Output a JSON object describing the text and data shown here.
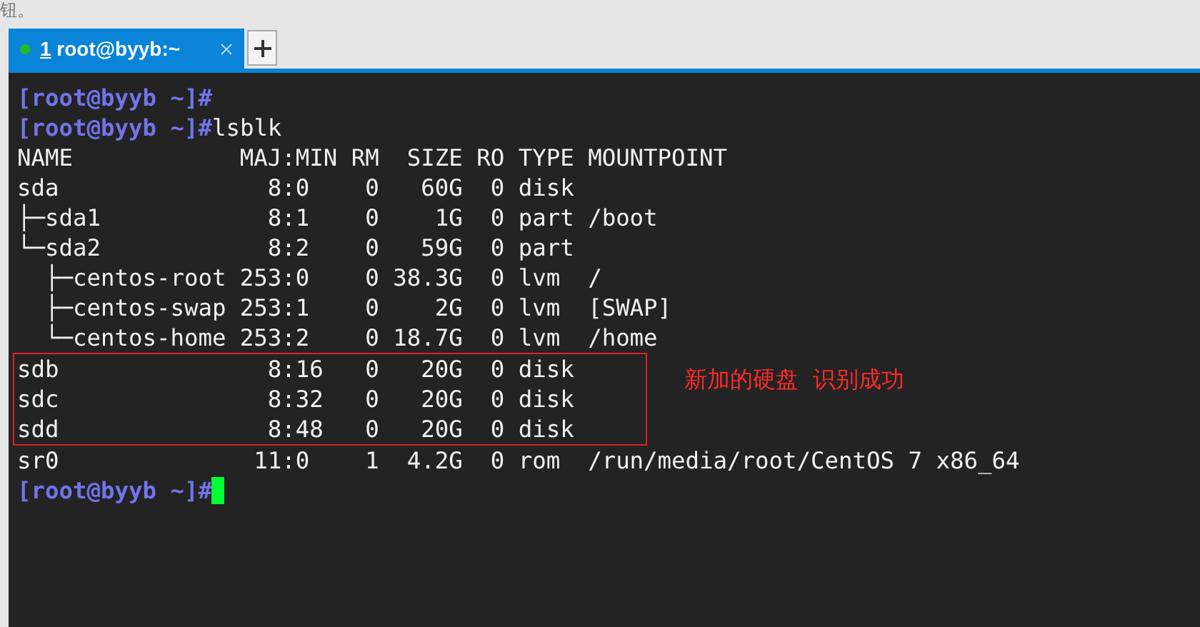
{
  "page_fragment": "钮。",
  "tabs": [
    {
      "number": "1",
      "label": "root@byyb:~",
      "selected": true
    }
  ],
  "terminal": {
    "lines": [
      {
        "kind": "prompt",
        "prompt": "[root@byyb ~]#"
      },
      {
        "kind": "prompt",
        "prompt": "[root@byyb ~]#",
        "command": "lsblk"
      },
      {
        "kind": "output",
        "text": "NAME            MAJ:MIN RM  SIZE RO TYPE MOUNTPOINT"
      },
      {
        "kind": "output",
        "text": "sda               8:0    0   60G  0 disk"
      },
      {
        "kind": "output",
        "text": "├─sda1            8:1    0    1G  0 part /boot"
      },
      {
        "kind": "output",
        "text": "└─sda2            8:2    0   59G  0 part"
      },
      {
        "kind": "output",
        "text": "  ├─centos-root 253:0    0 38.3G  0 lvm  /"
      },
      {
        "kind": "output",
        "text": "  ├─centos-swap 253:1    0    2G  0 lvm  [SWAP]"
      },
      {
        "kind": "output",
        "text": "  └─centos-home 253:2    0 18.7G  0 lvm  /home"
      }
    ],
    "highlight": {
      "lines": [
        {
          "kind": "output",
          "text": "sdb               8:16   0   20G  0 disk"
        },
        {
          "kind": "output",
          "text": "sdc               8:32   0   20G  0 disk"
        },
        {
          "kind": "output",
          "text": "sdd               8:48   0   20G  0 disk"
        }
      ],
      "label": "新加的硬盘  识别成功"
    },
    "lines_after": [
      {
        "kind": "output",
        "text": "sr0              11:0    1  4.2G  0 rom  /run/media/root/CentOS 7 x86_64"
      },
      {
        "kind": "prompt",
        "prompt": "[root@byyb ~]#"
      }
    ],
    "cursor": true
  }
}
